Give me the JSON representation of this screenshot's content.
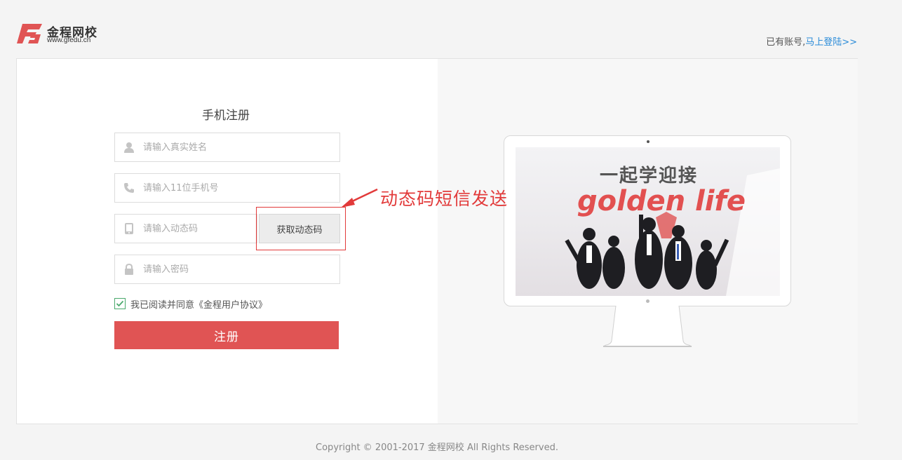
{
  "header": {
    "logo_name": "金程网校",
    "logo_url": "www.gfedu.cn",
    "login_prompt": "已有账号,",
    "login_link": "马上登陆>>"
  },
  "form": {
    "title": "手机注册",
    "name_placeholder": "请输入真实姓名",
    "phone_placeholder": "请输入11位手机号",
    "code_placeholder": "请输入动态码",
    "code_button": "获取动态码",
    "password_placeholder": "请输入密码",
    "agree_text": "我已阅读并同意《金程用户协议》",
    "agree_checked": true,
    "submit_label": "注册"
  },
  "annotation": {
    "text": "动态码短信发送",
    "color": "#e23a3a"
  },
  "promo": {
    "line1": "一起学迎接",
    "line2": "golden life"
  },
  "footer": {
    "copyright": "Copyright © 2001-2017 金程网校 All Rights Reserved."
  },
  "colors": {
    "brand_red": "#e05454",
    "link_blue": "#2a8bd8",
    "check_green": "#4aa96c"
  }
}
